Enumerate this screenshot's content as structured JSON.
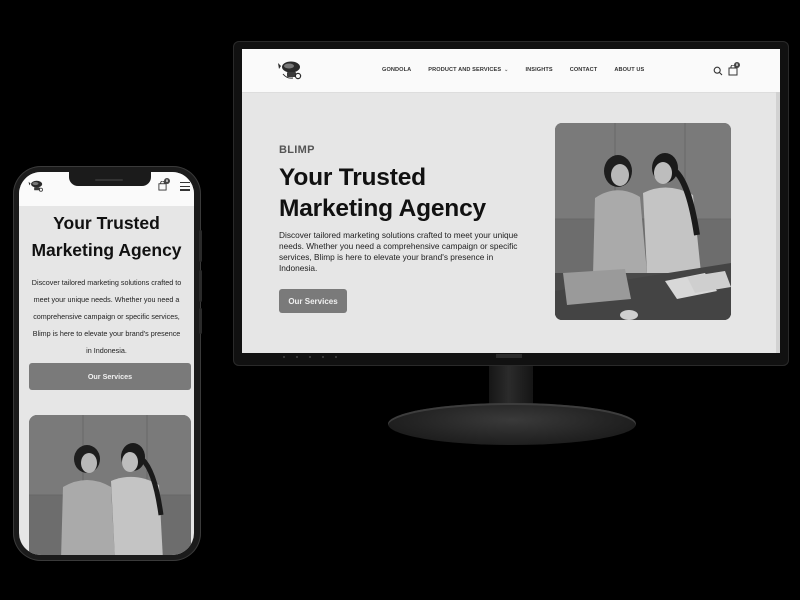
{
  "site": {
    "eyebrow": "BLIMP",
    "hero_title": "Your Trusted Marketing Agency",
    "hero_description": "Discover tailored marketing solutions crafted to meet your unique needs. Whether you need a comprehensive campaign or specific services, Blimp is here to elevate your brand's presence in Indonesia.",
    "cta_label": "Our Services",
    "cart_count": "0"
  },
  "nav": {
    "items": [
      {
        "label": "GONDOLA"
      },
      {
        "label": "PRODUCT AND SERVICES"
      },
      {
        "label": "INSIGHTS"
      },
      {
        "label": "CONTACT"
      },
      {
        "label": "ABOUT US"
      }
    ]
  },
  "icons": {
    "logo": "blimp-logo-icon",
    "search": "search-icon",
    "cart": "shopping-bag-icon",
    "menu": "hamburger-menu-icon",
    "dropdown": "chevron-down-icon"
  },
  "colors": {
    "page_bg": "#e6e6e6",
    "header_bg": "#fafafa",
    "button_bg": "#7a7a7a",
    "text": "#111111",
    "device": "#1b1b1b"
  }
}
